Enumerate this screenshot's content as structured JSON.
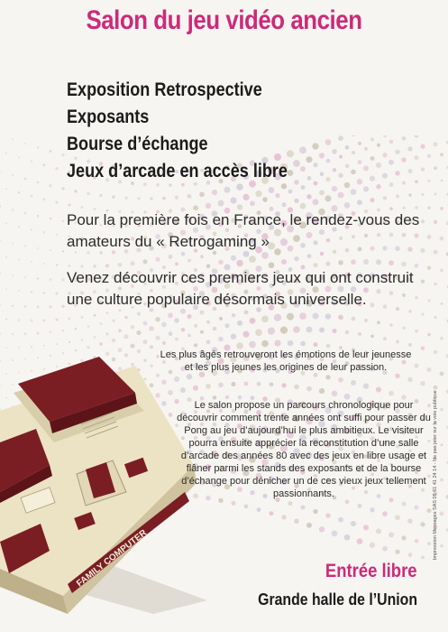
{
  "header": {
    "title": "Salon du jeu vidéo ancien"
  },
  "features": [
    "Exposition Retrospective",
    "Exposants",
    "Bourse d’échange",
    "Jeux d’arcade en accès libre"
  ],
  "intro": {
    "line1": "Pour la première fois en France, le rendez-vous des amateurs du « Retrogaming »",
    "line2": "Venez découvrir ces premiers jeux qui ont construit une culture populaire désormais universelle."
  },
  "details": {
    "para1": "Les plus âgés retrouveront les émotions de leur jeunesse et les plus jeunes les origines de leur passion.",
    "para2": "Le salon propose un parcours chronologique pour découvrir comment trente années ont suffi pour passer du Pong au jeu d’aujourd’hui le plus ambitieux. Le visiteur pourra ensuite apprécier la reconstitution d’une salle d’arcade des années 80 avec des jeux en libre usage et flâner parmi les stands des exposants et de la bourse d’échange pour dénicher un de ces vieux jeux tellement passionnants."
  },
  "console": {
    "brand": "FAMILY COMPUTER"
  },
  "footer": {
    "entry": "Entrée libre",
    "venue": "Grande halle de l’Union"
  },
  "side_note": "Impression Messages SAS 05 61 41 24 14 - Ne pas jeter sur la voie publique",
  "colors": {
    "accent": "#cc2a7a",
    "text": "#1b1b1b",
    "background": "#f7f5f1"
  }
}
